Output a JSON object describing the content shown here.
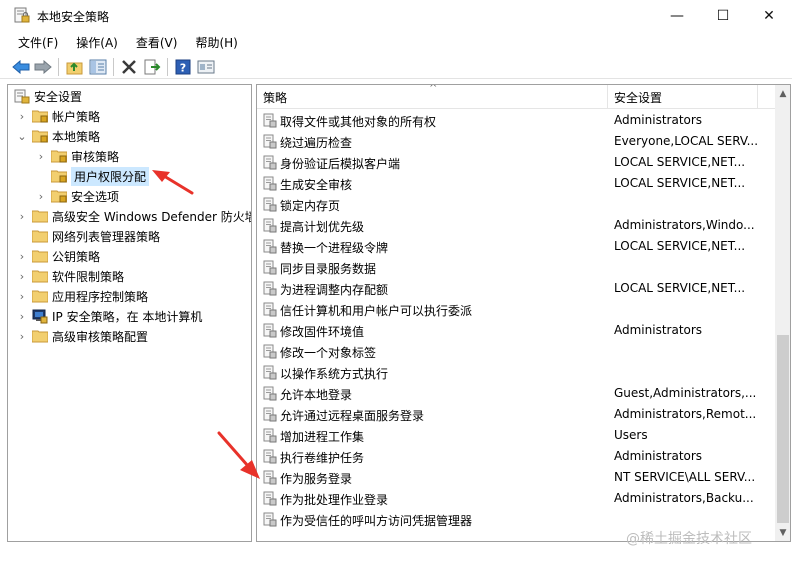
{
  "window": {
    "title": "本地安全策略",
    "controls": {
      "minimize": "—",
      "maximize": "☐",
      "close": "✕"
    }
  },
  "menu": {
    "items": [
      "文件(F)",
      "操作(A)",
      "查看(V)",
      "帮助(H)"
    ]
  },
  "toolbar": {
    "icons": [
      "back-icon",
      "forward-icon",
      "up-folder-icon",
      "show-hide-tree-icon",
      "delete-icon",
      "export-list-icon",
      "help-icon",
      "properties-icon"
    ]
  },
  "tree": {
    "items": [
      {
        "label": "安全设置",
        "chevron": "",
        "icon": "security-settings-icon"
      },
      {
        "label": "帐户策略",
        "chevron": "›",
        "icon": "folder-lock-icon"
      },
      {
        "label": "本地策略",
        "chevron": "⌄",
        "icon": "folder-lock-icon"
      },
      {
        "label": "审核策略",
        "chevron": "›",
        "icon": "folder-lock-icon"
      },
      {
        "label": "用户权限分配",
        "chevron": "",
        "icon": "folder-lock-icon",
        "selected": true
      },
      {
        "label": "安全选项",
        "chevron": "›",
        "icon": "folder-lock-icon"
      },
      {
        "label": "高级安全 Windows Defender 防火墙",
        "chevron": "›",
        "icon": "folder-icon"
      },
      {
        "label": "网络列表管理器策略",
        "chevron": "",
        "icon": "folder-icon"
      },
      {
        "label": "公钥策略",
        "chevron": "›",
        "icon": "folder-icon"
      },
      {
        "label": "软件限制策略",
        "chevron": "›",
        "icon": "folder-icon"
      },
      {
        "label": "应用程序控制策略",
        "chevron": "›",
        "icon": "folder-icon"
      },
      {
        "label": "IP 安全策略，在 本地计算机",
        "chevron": "›",
        "icon": "ip-security-icon"
      },
      {
        "label": "高级审核策略配置",
        "chevron": "›",
        "icon": "folder-icon"
      }
    ]
  },
  "list": {
    "columns": [
      "策略",
      "安全设置"
    ],
    "sort_arrow": "^",
    "rows": [
      {
        "policy": "取得文件或其他对象的所有权",
        "setting": "Administrators"
      },
      {
        "policy": "绕过遍历检查",
        "setting": "Everyone,LOCAL SERV..."
      },
      {
        "policy": "身份验证后模拟客户端",
        "setting": "LOCAL SERVICE,NET..."
      },
      {
        "policy": "生成安全审核",
        "setting": "LOCAL SERVICE,NET..."
      },
      {
        "policy": "锁定内存页",
        "setting": ""
      },
      {
        "policy": "提高计划优先级",
        "setting": "Administrators,Windo..."
      },
      {
        "policy": "替换一个进程级令牌",
        "setting": "LOCAL SERVICE,NET..."
      },
      {
        "policy": "同步目录服务数据",
        "setting": ""
      },
      {
        "policy": "为进程调整内存配额",
        "setting": "LOCAL SERVICE,NET..."
      },
      {
        "policy": "信任计算机和用户帐户可以执行委派",
        "setting": ""
      },
      {
        "policy": "修改固件环境值",
        "setting": "Administrators"
      },
      {
        "policy": "修改一个对象标签",
        "setting": ""
      },
      {
        "policy": "以操作系统方式执行",
        "setting": ""
      },
      {
        "policy": "允许本地登录",
        "setting": "Guest,Administrators,..."
      },
      {
        "policy": "允许通过远程桌面服务登录",
        "setting": "Administrators,Remot..."
      },
      {
        "policy": "增加进程工作集",
        "setting": "Users"
      },
      {
        "policy": "执行卷维护任务",
        "setting": "Administrators"
      },
      {
        "policy": "作为服务登录",
        "setting": "NT SERVICE\\ALL SERV..."
      },
      {
        "policy": "作为批处理作业登录",
        "setting": "Administrators,Backu..."
      },
      {
        "policy": "作为受信任的呼叫方访问凭据管理器",
        "setting": ""
      }
    ]
  },
  "watermark": "@稀土掘金技术社区",
  "colors": {
    "selection": "#cce8ff",
    "annotation_arrow": "#e8322a",
    "folder": "#f2cf6f"
  }
}
